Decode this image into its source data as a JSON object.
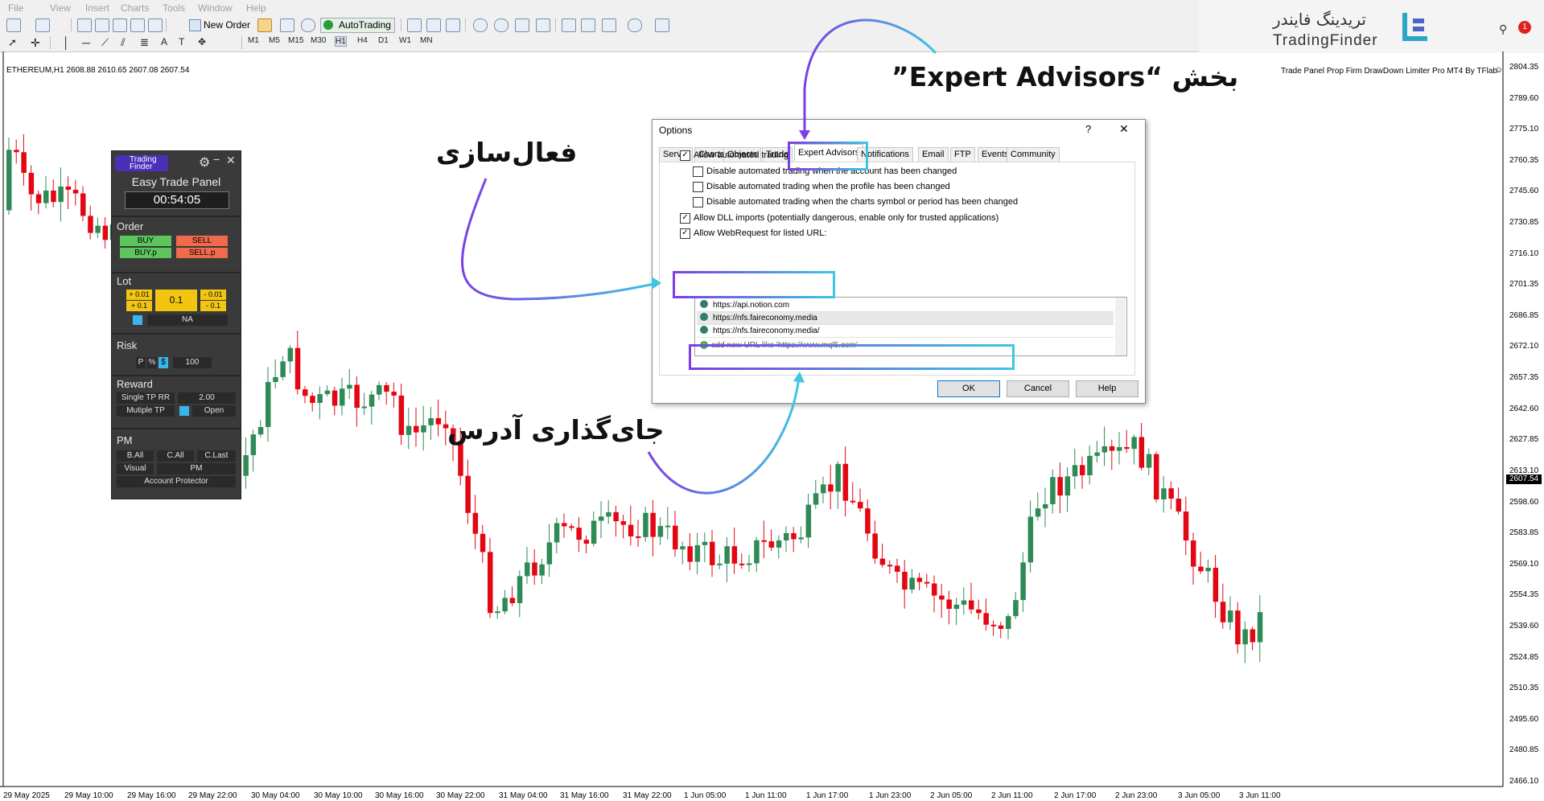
{
  "menu": [
    "File",
    "View",
    "Insert",
    "Charts",
    "Tools",
    "Window",
    "Help"
  ],
  "toolbar": {
    "new_order": "New Order",
    "autotrading": "AutoTrading",
    "timeframes": [
      "M1",
      "M5",
      "M15",
      "M30",
      "H1",
      "H4",
      "D1",
      "W1",
      "MN"
    ]
  },
  "logo": {
    "brand_fa": "تریدینگ فایندر",
    "brand_en": "TradingFinder"
  },
  "notification_count": "1",
  "chart": {
    "symbol_info": "ETHEREUM,H1  2608.88 2610.65 2607.08 2607.54",
    "indicator_title": "Trade Panel Prop Firm DrawDown Limiter Pro MT4 By TFlab",
    "current_price": "2607.54",
    "y_ticks": [
      "2804.35",
      "2789.60",
      "2775.10",
      "2760.35",
      "2745.60",
      "2730.85",
      "2716.10",
      "2701.35",
      "2686.85",
      "2672.10",
      "2657.35",
      "2642.60",
      "2627.85",
      "2613.10",
      "2598.60",
      "2583.85",
      "2569.10",
      "2554.35",
      "2539.60",
      "2524.85",
      "2510.35",
      "2495.60",
      "2480.85",
      "2466.10"
    ],
    "x_ticks": [
      "29 May 2025",
      "29 May 10:00",
      "29 May 16:00",
      "29 May 22:00",
      "30 May 04:00",
      "30 May 10:00",
      "30 May 16:00",
      "30 May 22:00",
      "31 May 04:00",
      "31 May 16:00",
      "31 May 22:00",
      "1 Jun 05:00",
      "1 Jun 11:00",
      "1 Jun 17:00",
      "1 Jun 23:00",
      "2 Jun 05:00",
      "2 Jun 11:00",
      "2 Jun 17:00",
      "2 Jun 23:00",
      "3 Jun 05:00",
      "3 Jun 11:00"
    ],
    "colors": {
      "bull": "#2e8b57",
      "bear": "#e30613"
    }
  },
  "panel": {
    "brand": "Trading Finder",
    "title": "Easy Trade Panel",
    "timer": "00:54:05",
    "order_label": "Order",
    "buy": "BUY",
    "sell": "SELL",
    "buy_p": "BUY.p",
    "sell_p": "SELL.p",
    "lot_label": "Lot",
    "lot_plus_001": "+ 0.01",
    "lot_plus_01": "+ 0.1",
    "lot_value": "0.1",
    "lot_minus_001": "- 0.01",
    "lot_minus_01": "- 0.1",
    "na": "NA",
    "risk_label": "Risk",
    "risk_p": "P",
    "risk_pct": "%",
    "risk_dollar": "$",
    "risk_value": "100",
    "reward_label": "Reward",
    "single_tp": "Single TP RR",
    "single_tp_value": "2.00",
    "multiple_tp": "Mutiple TP",
    "open": "Open",
    "pm_label": "PM",
    "b_all": "B.All",
    "c_all": "C.All",
    "c_last": "C.Last",
    "visual": "Visual",
    "pm": "PM",
    "account_protector": "Account Protector"
  },
  "dialog": {
    "title": "Options",
    "help_icon": "?",
    "close": "✕",
    "tabs": [
      "Server",
      "Charts",
      "Objects",
      "Trade",
      "Expert Advisors",
      "Notifications",
      "Email",
      "FTP",
      "Events",
      "Community"
    ],
    "options": [
      {
        "label": "Allow automated trading",
        "checked": true
      },
      {
        "label": "Disable automated trading when the account has been changed",
        "checked": false
      },
      {
        "label": "Disable automated trading when the profile has been changed",
        "checked": false
      },
      {
        "label": "Disable automated trading when the charts symbol or period has been changed",
        "checked": false
      },
      {
        "label": "Allow DLL imports (potentially dangerous, enable only for trusted applications)",
        "checked": true
      },
      {
        "label": "Allow WebRequest for listed URL:",
        "checked": true
      }
    ],
    "urls": [
      "https://api.notion.com",
      "https://nfs.faireconomy.media",
      "https://nfs.faireconomy.media/"
    ],
    "add_url": "add new URL like 'https://www.mql5.com'",
    "ok": "OK",
    "cancel": "Cancel",
    "help": "Help"
  },
  "annotations": {
    "expert_advisors": "بخش “Expert Advisors”",
    "activation": "فعال‌سازی",
    "address_placement": "جای‌گذاری آدرس"
  }
}
